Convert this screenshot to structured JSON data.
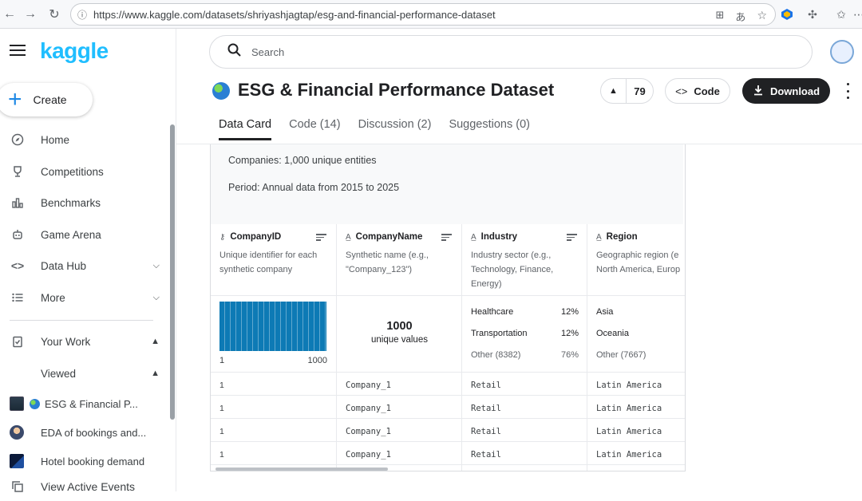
{
  "browser": {
    "url": "https://www.kaggle.com/datasets/shriyashjagtap/esg-and-financial-performance-dataset"
  },
  "sidebar": {
    "logo": "kaggle",
    "create_label": "Create",
    "nav": [
      {
        "label": "Home",
        "icon": "compass-icon"
      },
      {
        "label": "Competitions",
        "icon": "trophy-icon"
      },
      {
        "label": "Benchmarks",
        "icon": "bar-chart-icon"
      },
      {
        "label": "Game Arena",
        "icon": "robot-icon"
      },
      {
        "label": "Data Hub",
        "icon": "code-brackets-icon"
      },
      {
        "label": "More",
        "icon": "list-icon"
      }
    ],
    "your_work_label": "Your Work",
    "viewed_label": "Viewed",
    "viewed_items": [
      {
        "label": "ESG & Financial P..."
      },
      {
        "label": "EDA of bookings and..."
      },
      {
        "label": "Hotel booking demand"
      }
    ],
    "view_active_events": "View Active Events"
  },
  "header": {
    "search_placeholder": "Search",
    "dataset_title": "ESG & Financial Performance Dataset",
    "vote_count": "79",
    "code_label": "Code",
    "download_label": "Download",
    "tabs": [
      {
        "label": "Data Card",
        "active": true
      },
      {
        "label": "Code (14)",
        "active": false
      },
      {
        "label": "Discussion (2)",
        "active": false
      },
      {
        "label": "Suggestions (0)",
        "active": false
      }
    ]
  },
  "about": {
    "companies": "Companies: 1,000 unique entities",
    "period": "Period: Annual data from 2015 to 2025"
  },
  "columns": [
    {
      "name": "CompanyID",
      "type_icon": "key-icon",
      "desc": [
        "Unique identifier for each",
        "synthetic company"
      ],
      "hist_min": "1",
      "hist_max": "1000"
    },
    {
      "name": "CompanyName",
      "type_icon": "text-type-icon",
      "desc": [
        "Synthetic name (e.g.,",
        "\"Company_123\")"
      ],
      "unique_count": "1000",
      "unique_label": "unique values"
    },
    {
      "name": "Industry",
      "type_icon": "text-type-icon",
      "desc": [
        "Industry sector (e.g.,",
        "Technology, Finance,",
        "Energy)"
      ],
      "stats": [
        [
          "Healthcare",
          "12%"
        ],
        [
          "Transportation",
          "12%"
        ],
        [
          "Other (8382)",
          "76%"
        ]
      ]
    },
    {
      "name": "Region",
      "type_icon": "text-type-icon",
      "desc": [
        "Geographic region (e",
        "North America, Europ"
      ],
      "stats": [
        [
          "Asia",
          ""
        ],
        [
          "Oceania",
          ""
        ],
        [
          "Other (7667)",
          ""
        ]
      ]
    }
  ],
  "rows": [
    [
      "1",
      "Company_1",
      "Retail",
      "Latin America"
    ],
    [
      "1",
      "Company_1",
      "Retail",
      "Latin America"
    ],
    [
      "1",
      "Company_1",
      "Retail",
      "Latin America"
    ],
    [
      "1",
      "Company_1",
      "Retail",
      "Latin America"
    ]
  ]
}
